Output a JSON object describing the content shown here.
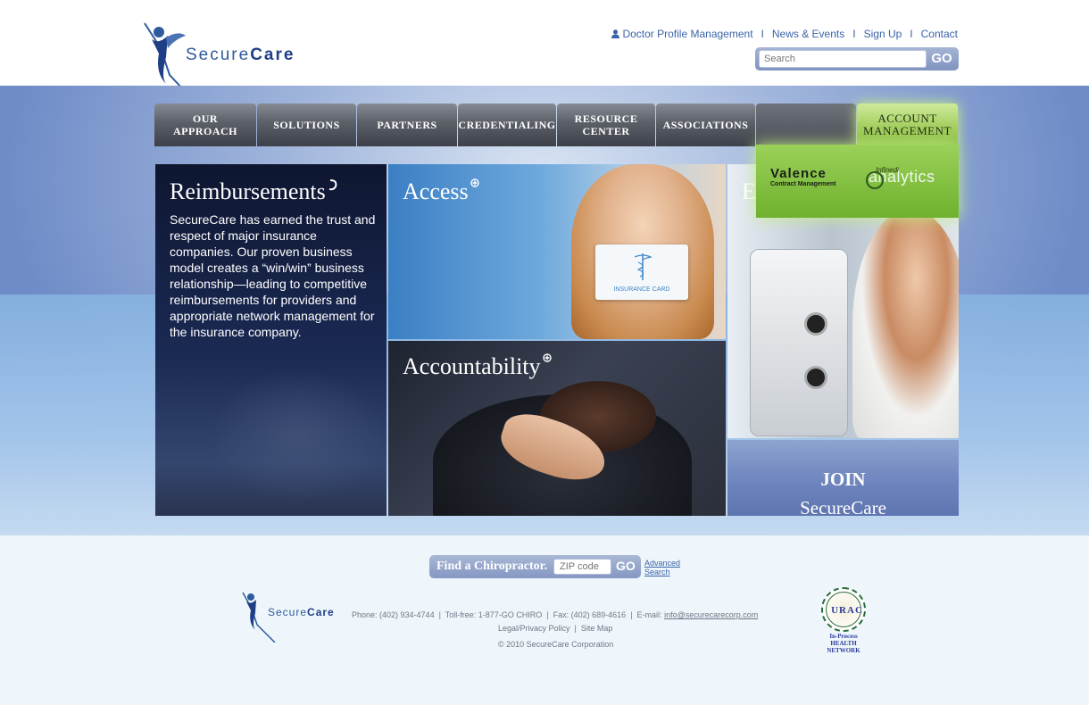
{
  "brand": {
    "name_part1": "Secure",
    "name_part2": "Care"
  },
  "header": {
    "links": [
      {
        "label": "Doctor Profile Management",
        "icon": "person-icon"
      },
      {
        "label": "News & Events"
      },
      {
        "label": "Sign Up"
      },
      {
        "label": "Contact"
      }
    ],
    "separator": "I",
    "search": {
      "placeholder": "Search",
      "button_label": "GO"
    }
  },
  "nav": {
    "items": [
      {
        "label": "OUR\nAPPROACH"
      },
      {
        "label": "SOLUTIONS"
      },
      {
        "label": "PARTNERS"
      },
      {
        "label": "CREDENTIALING"
      },
      {
        "label": "RESOURCE\nCENTER"
      },
      {
        "label": "ASSOCIATIONS"
      },
      {
        "label": ""
      },
      {
        "label": "ACCOUNT\nMANAGEMENT",
        "active": true
      }
    ],
    "dropdown": {
      "valence_title": "Valence",
      "valence_sub": "Contract Management",
      "analytics_pre": "Infinedi",
      "analytics_label": "analytics"
    }
  },
  "panels": {
    "reimbursements": {
      "title": "Reimbursements",
      "body": "SecureCare has earned the trust and respect of major insurance companies. Our proven business model creates a “win/win” business relationship—leading to competitive reimbursements for providers and appropriate network management for the insurance company."
    },
    "access": {
      "title": "Access",
      "card_label": "INSURANCE CARD"
    },
    "accountability": {
      "title": "Accountability"
    },
    "expertise": {
      "title": "E"
    },
    "join": {
      "label_bold": "JOIN",
      "label_rest": "SecureCare"
    }
  },
  "footer": {
    "finder": {
      "label": "Find a Chiropractor.",
      "placeholder": "ZIP code",
      "button_label": "GO"
    },
    "advanced_search": "Advanced Search",
    "phone": "Phone: (402) 934-4744",
    "tollfree": "Toll-free: 1-877-GO CHIRO",
    "fax": "Fax: (402) 689-4616",
    "email_label": "E-mail:",
    "email": "info@securecarecorp.com",
    "legal": "Legal/Privacy Policy",
    "sitemap": "Site Map",
    "copyright": "© 2010 SecureCare Corporation",
    "urac": {
      "letters": "URAC",
      "line1": "In-Process",
      "line2": "HEALTH NETWORK"
    }
  },
  "colors": {
    "brand_blue": "#2e5a9e",
    "nav_active": "#a8d165",
    "link": "#3a63a8"
  }
}
